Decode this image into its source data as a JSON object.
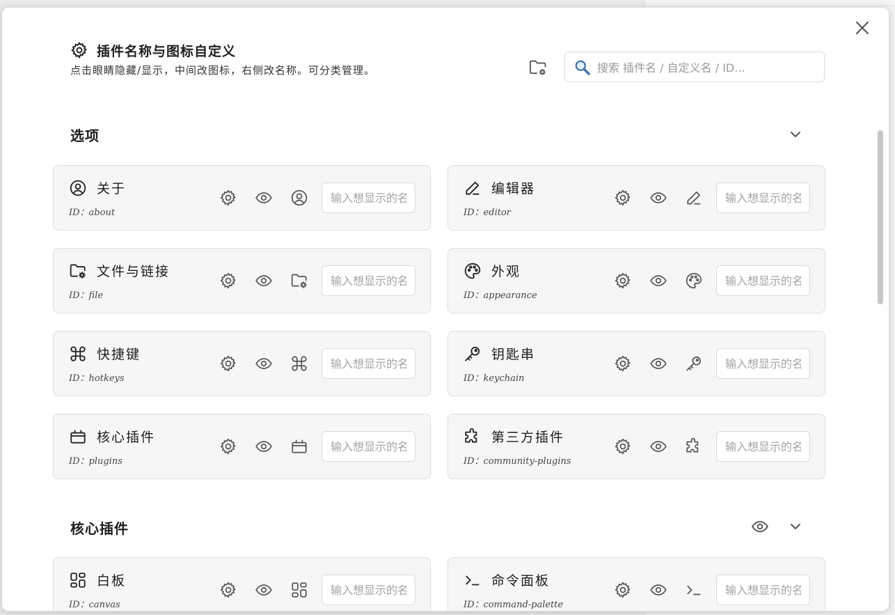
{
  "header": {
    "icon": "gear-icon",
    "title": "插件名称与图标自定义",
    "subtitle": "点击眼睛隐藏/显示，中间改图标，右侧改名称。可分类管理。",
    "folder_icon": "folder-gear-icon",
    "search_placeholder": "搜索 插件名 / 自定义名 / ID..."
  },
  "rename_placeholder": "输入想显示的名称",
  "sections": [
    {
      "title": "选项",
      "items": [
        {
          "icon": "user-circle-icon",
          "name": "关于",
          "id": "ID：about"
        },
        {
          "icon": "pencil-icon",
          "name": "编辑器",
          "id": "ID：editor"
        },
        {
          "icon": "folder-gear-icon",
          "name": "文件与链接",
          "id": "ID：file"
        },
        {
          "icon": "palette-icon",
          "name": "外观",
          "id": "ID：appearance"
        },
        {
          "icon": "command-icon",
          "name": "快捷键",
          "id": "ID：hotkeys"
        },
        {
          "icon": "key-icon",
          "name": "钥匙串",
          "id": "ID：keychain"
        },
        {
          "icon": "plugins-box-icon",
          "name": "核心插件",
          "id": "ID：plugins"
        },
        {
          "icon": "puzzle-icon",
          "name": "第三方插件",
          "id": "ID：community-plugins"
        }
      ]
    },
    {
      "title": "核心插件",
      "items": [
        {
          "icon": "canvas-grid-icon",
          "name": "白板",
          "id": "ID：canvas"
        },
        {
          "icon": "terminal-icon",
          "name": "命令面板",
          "id": "ID：command-palette"
        }
      ]
    }
  ]
}
